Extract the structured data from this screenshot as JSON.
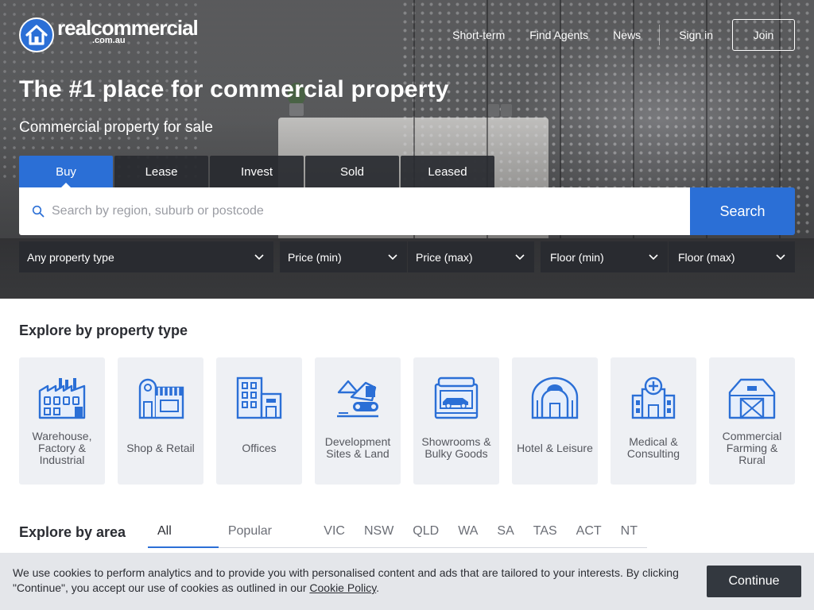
{
  "brand": {
    "name": "realcommercial",
    "tld": ".com.au",
    "color": "#2b6fd6"
  },
  "nav": {
    "links": [
      "Short-term",
      "Find Agents",
      "News"
    ],
    "sign_in": "Sign in",
    "join": "Join"
  },
  "hero": {
    "title": "The #1 place for commercial property",
    "subtitle": "Commercial property for sale"
  },
  "search_tabs": [
    {
      "label": "Buy",
      "active": true
    },
    {
      "label": "Lease",
      "active": false
    },
    {
      "label": "Invest",
      "active": false
    },
    {
      "label": "Sold",
      "active": false
    },
    {
      "label": "Leased",
      "active": false
    }
  ],
  "search": {
    "placeholder": "Search by region, suburb or postcode",
    "value": "",
    "button": "Search",
    "icon": "search-icon"
  },
  "filters": {
    "property_type": "Any property type",
    "price_min": "Price (min)",
    "price_max": "Price (max)",
    "floor_min": "Floor (min)",
    "floor_max": "Floor (max)"
  },
  "explore_type": {
    "title": "Explore by property type",
    "tiles": [
      {
        "label": "Warehouse, Factory & Industrial",
        "icon": "factory-icon"
      },
      {
        "label": "Shop & Retail",
        "icon": "shop-icon"
      },
      {
        "label": "Offices",
        "icon": "office-building-icon"
      },
      {
        "label": "Development Sites & Land",
        "icon": "excavator-icon"
      },
      {
        "label": "Showrooms & Bulky Goods",
        "icon": "car-showroom-icon"
      },
      {
        "label": "Hotel & Leisure",
        "icon": "hotel-icon"
      },
      {
        "label": "Medical & Consulting",
        "icon": "medical-building-icon"
      },
      {
        "label": "Commercial Farming & Rural",
        "icon": "barn-icon"
      }
    ]
  },
  "explore_area": {
    "title": "Explore by area",
    "tabs": [
      {
        "label": "All States",
        "active": true
      },
      {
        "label": "Popular Areas",
        "active": false
      },
      {
        "label": "VIC",
        "active": false
      },
      {
        "label": "NSW",
        "active": false
      },
      {
        "label": "QLD",
        "active": false
      },
      {
        "label": "WA",
        "active": false
      },
      {
        "label": "SA",
        "active": false
      },
      {
        "label": "TAS",
        "active": false
      },
      {
        "label": "ACT",
        "active": false
      },
      {
        "label": "NT",
        "active": false
      }
    ]
  },
  "cookie": {
    "text_before": "We use cookies to perform analytics and to provide you with personalised content and ads that are tailored to your interests. By clicking \"Continue\", you accept our use of cookies as outlined in our ",
    "link": "Cookie Policy",
    "text_after": ".",
    "button": "Continue"
  },
  "colors": {
    "accent": "#2b6fd6",
    "dark_panel": "#282a30",
    "tile_bg": "#eef0f4",
    "cookie_bg": "#e4e6ea"
  }
}
